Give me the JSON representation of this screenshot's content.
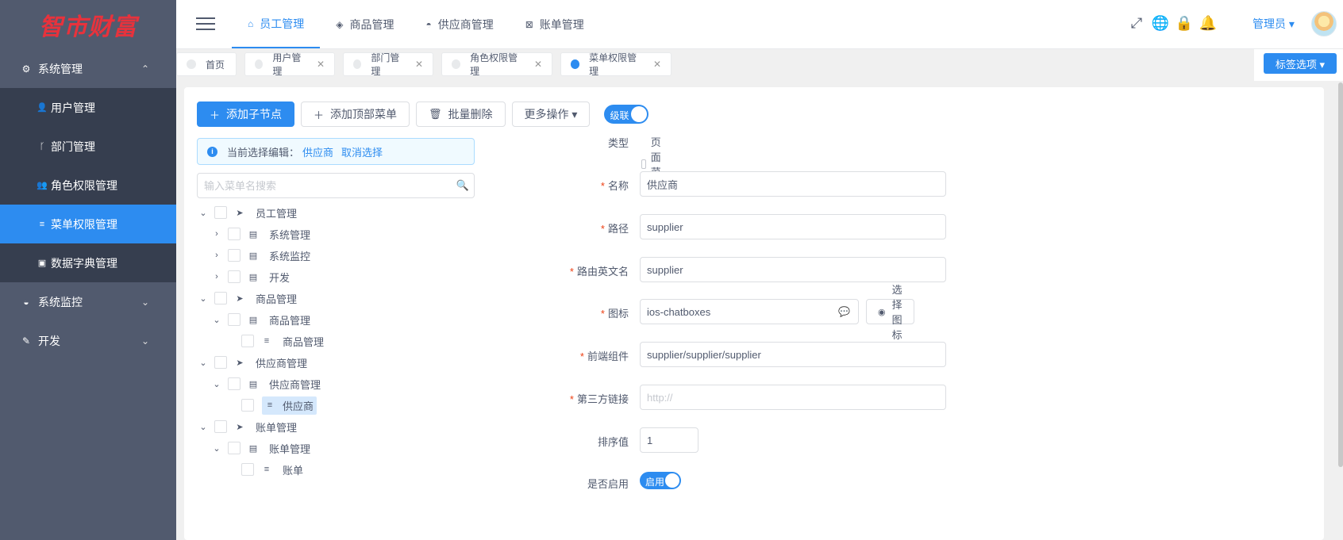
{
  "logo": {
    "text": "智市财富"
  },
  "sidebar": {
    "groups": [
      {
        "label": "系统管理",
        "icon": "gear-icon",
        "glyph": "⚙",
        "chevron": "⌃"
      },
      {
        "label": "系统监控",
        "icon": "dashboard-icon",
        "glyph": "◒",
        "chevron": "⌄"
      },
      {
        "label": "开发",
        "icon": "clipboard-icon",
        "glyph": "✎",
        "chevron": "⌄"
      }
    ],
    "items": [
      {
        "label": "用户管理",
        "icon": "user-icon",
        "glyph": "👤"
      },
      {
        "label": "部门管理",
        "icon": "branch-icon",
        "glyph": "ᚴ"
      },
      {
        "label": "角色权限管理",
        "icon": "people-icon",
        "glyph": "👥"
      },
      {
        "label": "菜单权限管理",
        "icon": "list-icon",
        "glyph": "≡",
        "active": true
      },
      {
        "label": "数据字典管理",
        "icon": "book-icon",
        "glyph": "▣"
      }
    ]
  },
  "header": {
    "nav": [
      {
        "label": "员工管理",
        "icon": "home-icon",
        "glyph": "⌂",
        "active": true
      },
      {
        "label": "商品管理",
        "icon": "tag-icon",
        "glyph": "◈"
      },
      {
        "label": "供应商管理",
        "icon": "truck-icon",
        "glyph": "◓"
      },
      {
        "label": "账单管理",
        "icon": "bill-icon",
        "glyph": "⊠"
      }
    ],
    "icons": [
      {
        "name": "fullscreen-icon",
        "glyph": "⤢"
      },
      {
        "name": "globe-icon",
        "glyph": "🌐"
      },
      {
        "name": "lock-icon",
        "glyph": "🔒"
      },
      {
        "name": "bell-icon",
        "glyph": "🔔"
      }
    ],
    "user": "管理员 ▾"
  },
  "tags": {
    "items": [
      {
        "label": "首页",
        "closable": false
      },
      {
        "label": "用户管理",
        "closable": true
      },
      {
        "label": "部门管理",
        "closable": true
      },
      {
        "label": "角色权限管理",
        "closable": true
      },
      {
        "label": "菜单权限管理",
        "closable": true,
        "active": true
      }
    ],
    "close_glyph": "✕",
    "options_label": "标签选项 ▾"
  },
  "toolbar": {
    "add_child": "添加子节点",
    "add_top": "添加顶部菜单",
    "batch_delete": "批量删除",
    "more": "更多操作 ▾",
    "cascade": "级联"
  },
  "alert": {
    "prefix": "当前选择编辑：",
    "selected": "供应商",
    "cancel": "取消选择"
  },
  "search": {
    "placeholder": "输入菜单名搜索"
  },
  "tree": [
    {
      "label": "员工管理",
      "level": 0,
      "expanded": true,
      "type": "top"
    },
    {
      "label": "系统管理",
      "level": 1,
      "expanded": false,
      "type": "folder"
    },
    {
      "label": "系统监控",
      "level": 1,
      "expanded": false,
      "type": "folder"
    },
    {
      "label": "开发",
      "level": 1,
      "expanded": false,
      "type": "folder"
    },
    {
      "label": "商品管理",
      "level": 0,
      "expanded": true,
      "type": "top"
    },
    {
      "label": "商品管理",
      "level": 1,
      "expanded": true,
      "type": "folder"
    },
    {
      "label": "商品管理",
      "level": 2,
      "type": "leaf"
    },
    {
      "label": "供应商管理",
      "level": 0,
      "expanded": true,
      "type": "top"
    },
    {
      "label": "供应商管理",
      "level": 1,
      "expanded": true,
      "type": "folder"
    },
    {
      "label": "供应商",
      "level": 2,
      "type": "leaf",
      "selected": true
    },
    {
      "label": "账单管理",
      "level": 0,
      "expanded": true,
      "type": "top"
    },
    {
      "label": "账单管理",
      "level": 1,
      "expanded": true,
      "type": "folder"
    },
    {
      "label": "账单",
      "level": 2,
      "type": "leaf"
    }
  ],
  "form": {
    "type_label": "类型",
    "type_option": "页面菜单",
    "name_label": "名称",
    "name_value": "供应商",
    "path_label": "路径",
    "path_value": "supplier",
    "route_label": "路由英文名",
    "route_value": "supplier",
    "icon_label": "图标",
    "icon_value": "ios-chatboxes",
    "icon_button": "选择图标",
    "component_label": "前端组件",
    "component_value": "supplier/supplier/supplier",
    "link_label": "第三方链接",
    "link_placeholder": "http://",
    "sort_label": "排序值",
    "sort_value": "1",
    "enabled_label": "是否启用",
    "enabled_value": "启用"
  },
  "colors": {
    "primary": "#2d8cf0",
    "sidebar_bg": "#515a6e",
    "submenu_bg": "#363e4f",
    "required": "#ed4014",
    "logo": "#e8323c"
  }
}
